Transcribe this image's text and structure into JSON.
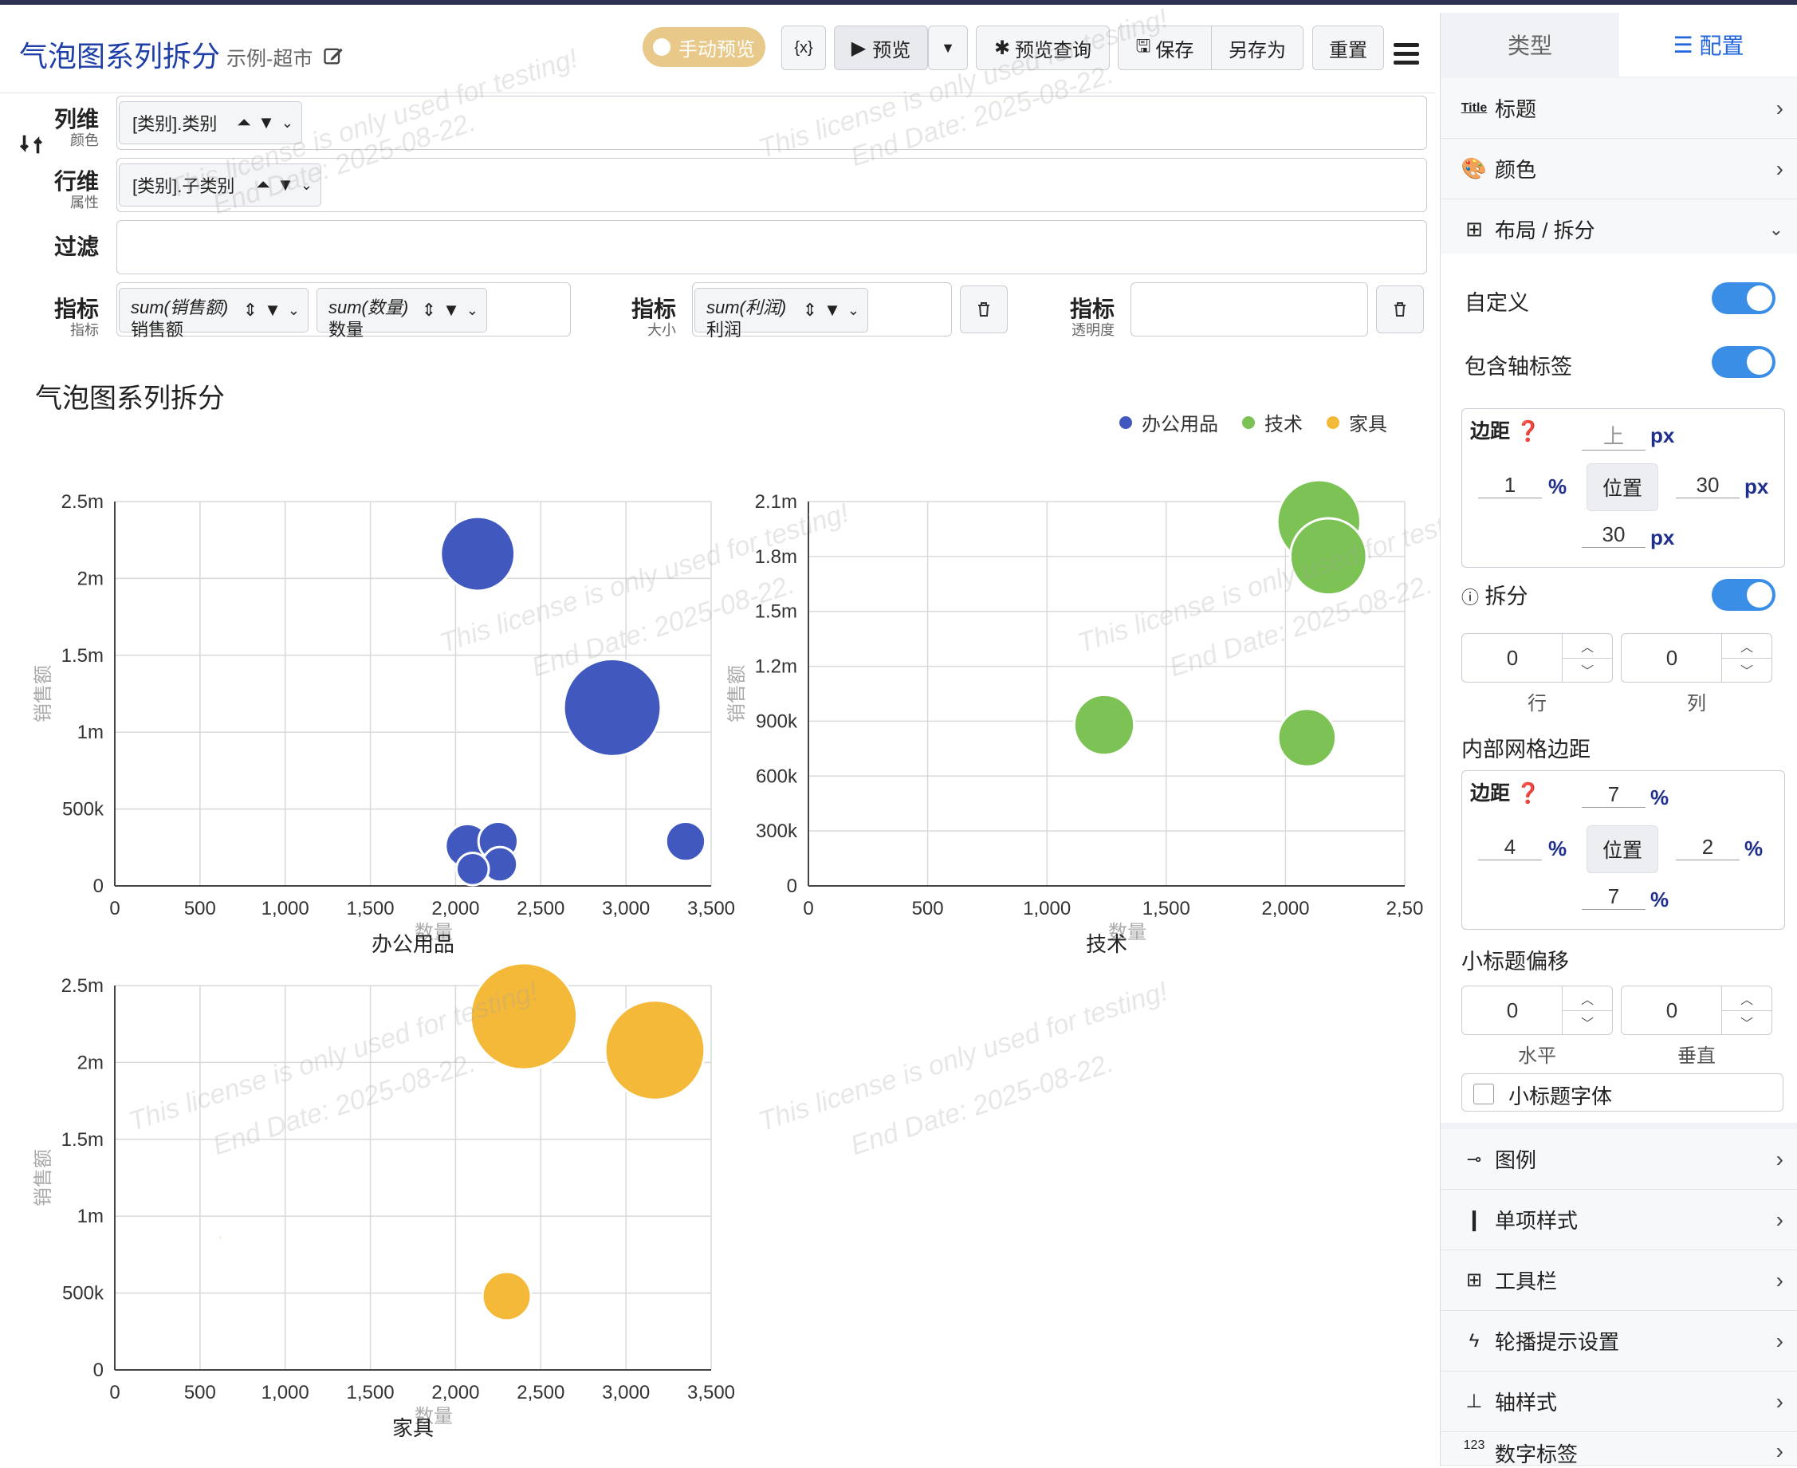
{
  "header": {
    "title": "气泡图系列拆分",
    "subtitle": "示例-超市",
    "manual_preview": "手动预览",
    "var_btn": "{x}",
    "preview": "预览",
    "preview_query": "预览查询",
    "save": "保存",
    "save_as": "另存为",
    "reset": "重置"
  },
  "dims": {
    "col_label": "列维",
    "col_sub": "颜色",
    "col_chip": "[类别].类别",
    "row_label": "行维",
    "row_sub": "属性",
    "row_chip": "[类别].子类别",
    "filter_label": "过滤",
    "m1_label": "指标",
    "m1_sub": "指标",
    "m1_chip1_a": "sum(销售额)",
    "m1_chip1_b": "销售额",
    "m1_chip2_a": "sum(数量)",
    "m1_chip2_b": "数量",
    "m2_label": "指标",
    "m2_sub": "大小",
    "m2_chip_a": "sum(利润)",
    "m2_chip_b": "利润",
    "m3_label": "指标",
    "m3_sub": "透明度"
  },
  "chart": {
    "title": "气泡图系列拆分",
    "legend": [
      {
        "name": "办公用品",
        "color": "#4159bf"
      },
      {
        "name": "技术",
        "color": "#7cc254"
      },
      {
        "name": "家具",
        "color": "#f5b93a"
      }
    ],
    "watermark_1": "This license is only used for testing!",
    "watermark_2": "End Date: 2025-08-22."
  },
  "chart_data": [
    {
      "type": "scatter",
      "title": "办公用品",
      "xlabel": "数量",
      "ylabel": "销售额",
      "xlim": [
        0,
        3500
      ],
      "ylim": [
        0,
        2500000
      ],
      "x_ticks": [
        "0",
        "500",
        "1,000",
        "1,500",
        "2,000",
        "2,500",
        "3,000",
        "3,500"
      ],
      "y_ticks": [
        "0",
        "500k",
        "1m",
        "1.5m",
        "2m",
        "2.5m"
      ],
      "color": "#4159bf",
      "points": [
        {
          "x": 2130,
          "y": 2160000,
          "r": 32
        },
        {
          "x": 2920,
          "y": 1160000,
          "r": 42
        },
        {
          "x": 3350,
          "y": 290000,
          "r": 17
        },
        {
          "x": 2070,
          "y": 260000,
          "r": 19
        },
        {
          "x": 2250,
          "y": 290000,
          "r": 17
        },
        {
          "x": 2100,
          "y": 110000,
          "r": 14
        },
        {
          "x": 2260,
          "y": 140000,
          "r": 15
        }
      ]
    },
    {
      "type": "scatter",
      "title": "技术",
      "xlabel": "数量",
      "ylabel": "销售额",
      "xlim": [
        0,
        2500
      ],
      "ylim": [
        0,
        2100000
      ],
      "x_ticks": [
        "0",
        "500",
        "1,000",
        "1,500",
        "2,000",
        "2,50"
      ],
      "y_ticks": [
        "0",
        "300k",
        "600k",
        "900k",
        "1.2m",
        "1.5m",
        "1.8m",
        "2.1m"
      ],
      "color": "#7cc254",
      "points": [
        {
          "x": 2180,
          "y": 1800000,
          "r": 33
        },
        {
          "x": 2140,
          "y": 1990000,
          "r": 36
        },
        {
          "x": 1240,
          "y": 880000,
          "r": 26
        },
        {
          "x": 2090,
          "y": 810000,
          "r": 25
        }
      ]
    },
    {
      "type": "scatter",
      "title": "家具",
      "xlabel": "数量",
      "ylabel": "销售额",
      "xlim": [
        0,
        3500
      ],
      "ylim": [
        0,
        2500000
      ],
      "x_ticks": [
        "0",
        "500",
        "1,000",
        "1,500",
        "2,000",
        "2,500",
        "3,000",
        "3,500"
      ],
      "y_ticks": [
        "0",
        "500k",
        "1m",
        "1.5m",
        "2m",
        "2.5m"
      ],
      "color": "#f5b93a",
      "points": [
        {
          "x": 2400,
          "y": 2300000,
          "r": 46
        },
        {
          "x": 3170,
          "y": 2080000,
          "r": 43
        },
        {
          "x": 2300,
          "y": 480000,
          "r": 21
        },
        {
          "x": 620,
          "y": 860000,
          "r": 1.5
        }
      ]
    }
  ],
  "side": {
    "tab_type": "类型",
    "tab_config": "配置",
    "title_row": "标题",
    "title_badge": "Title",
    "color_row": "颜色",
    "layout_row": "布局 / 拆分",
    "custom": "自定义",
    "include_axis": "包含轴标签",
    "margin_label": "边距",
    "margin_top_ph": "上",
    "margin_left": "1",
    "margin_right": "30",
    "margin_bottom": "30",
    "unit_px": "px",
    "unit_pct": "%",
    "position_btn": "位置",
    "split_label": "拆分",
    "split_row_val": "0",
    "split_col_val": "0",
    "split_row_cap": "行",
    "split_col_cap": "列",
    "inner_grid": "内部网格边距",
    "inner_margin_label": "边距",
    "inner_top": "7",
    "inner_left": "4",
    "inner_right": "2",
    "inner_bottom": "7",
    "subtitle_offset": "小标题偏移",
    "off_h_val": "0",
    "off_v_val": "0",
    "off_h_cap": "水平",
    "off_v_cap": "垂直",
    "subtitle_font": "小标题字体",
    "legend_row": "图例",
    "item_style_row": "单项样式",
    "toolbar_row": "工具栏",
    "carousel_row": "轮播提示设置",
    "axis_style_row": "轴样式",
    "number_label_row": "数字标签",
    "number_badge": "123"
  }
}
